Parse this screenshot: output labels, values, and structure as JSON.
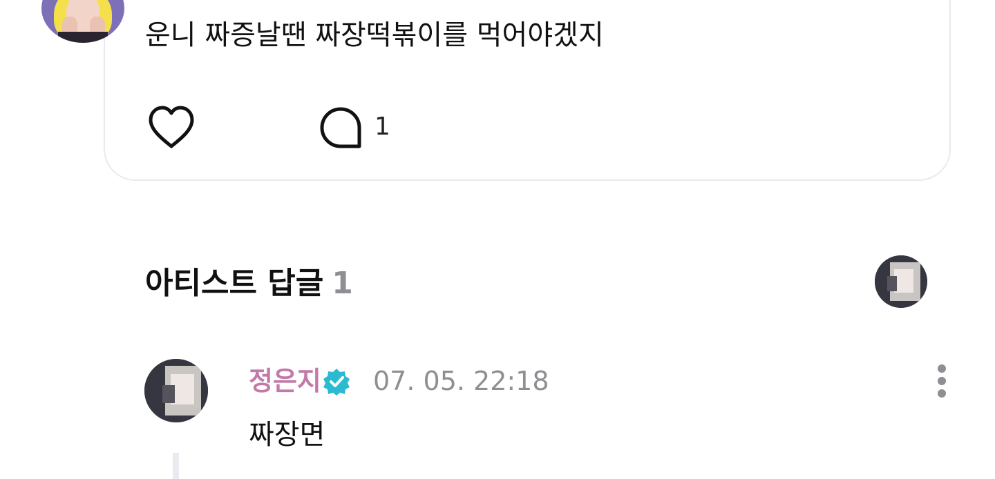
{
  "post": {
    "text": "운니 짜증날땐 짜장떡볶이를 먹어야겠지",
    "like_icon": "heart-outline-icon",
    "comment_icon": "speech-bubble-icon",
    "comment_count": "1"
  },
  "artist_replies": {
    "title": "아티스트 답글",
    "count": "1"
  },
  "reply": {
    "author": "정은지",
    "verified_icon": "verified-badge-icon",
    "timestamp": "07. 05. 22:18",
    "text": "짜장면",
    "more_icon": "vertical-dots-icon"
  },
  "colors": {
    "author_name": "#c27aa8",
    "verified_badge": "#2bbbd0",
    "muted_text": "#8e8e93",
    "card_border": "#e9e9ef"
  }
}
